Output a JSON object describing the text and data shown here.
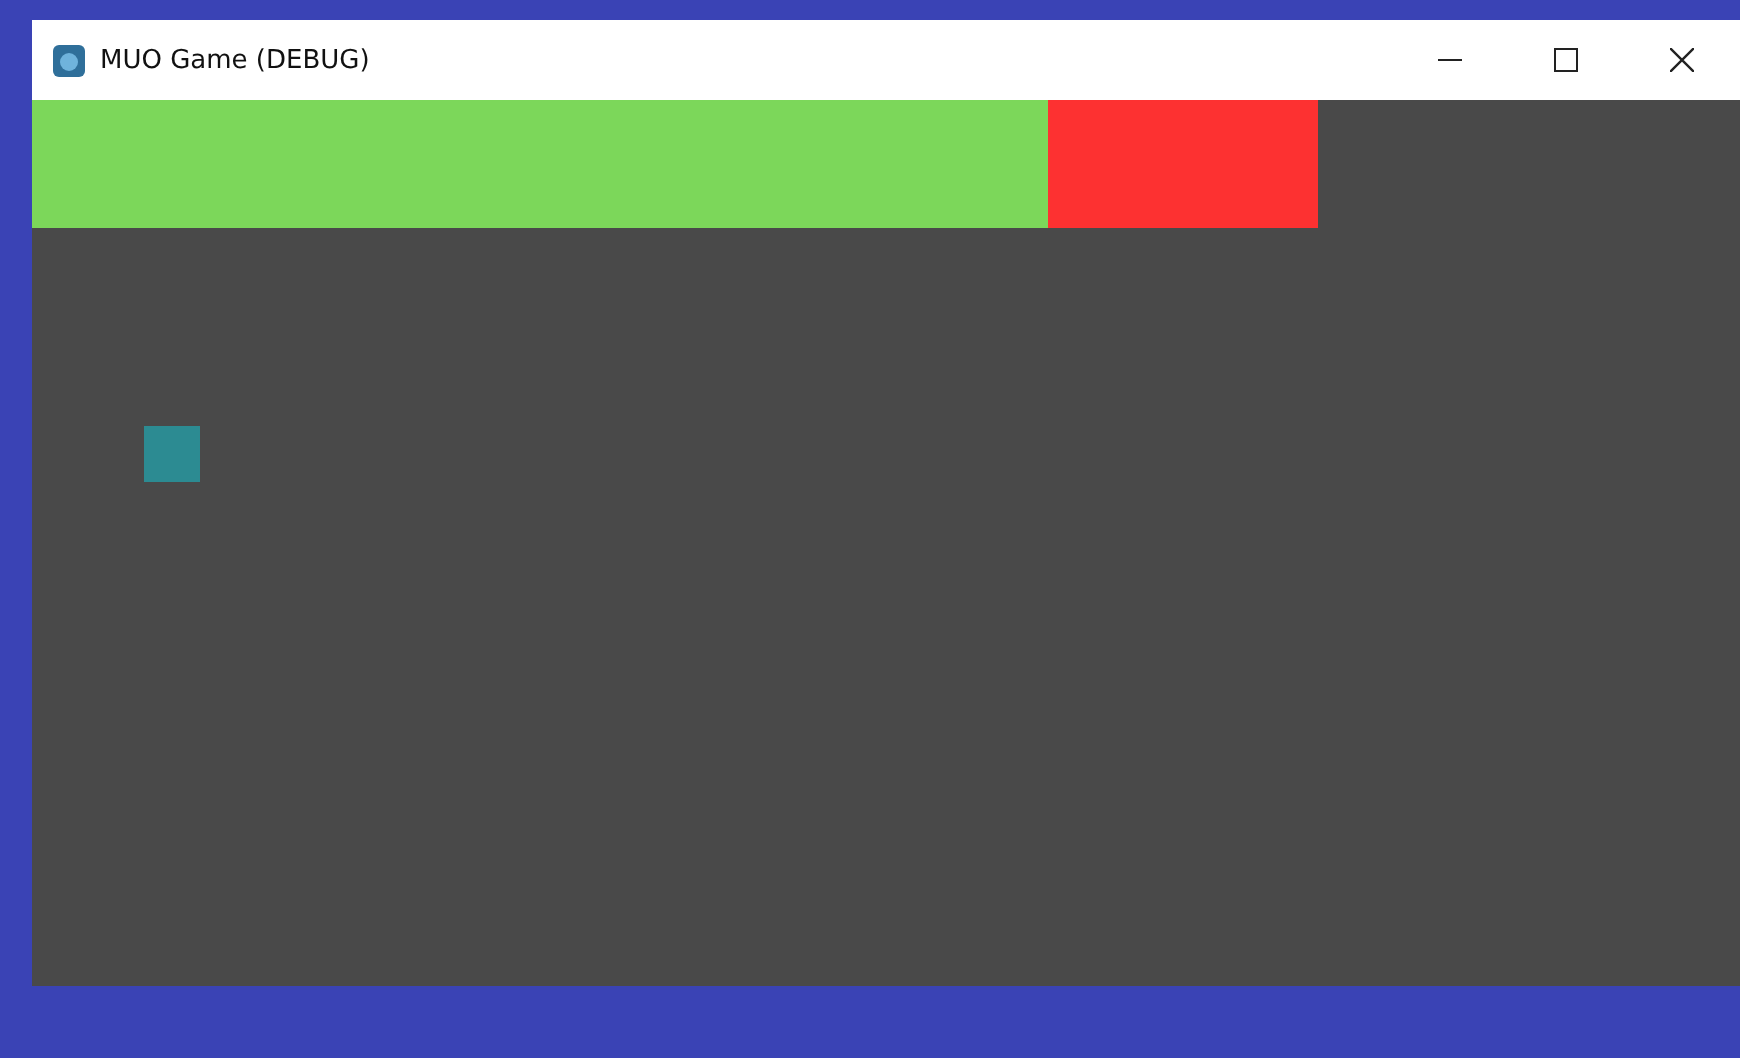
{
  "window": {
    "title": "MUO Game (DEBUG)"
  },
  "health_bar": {
    "level": 0.79
  }
}
